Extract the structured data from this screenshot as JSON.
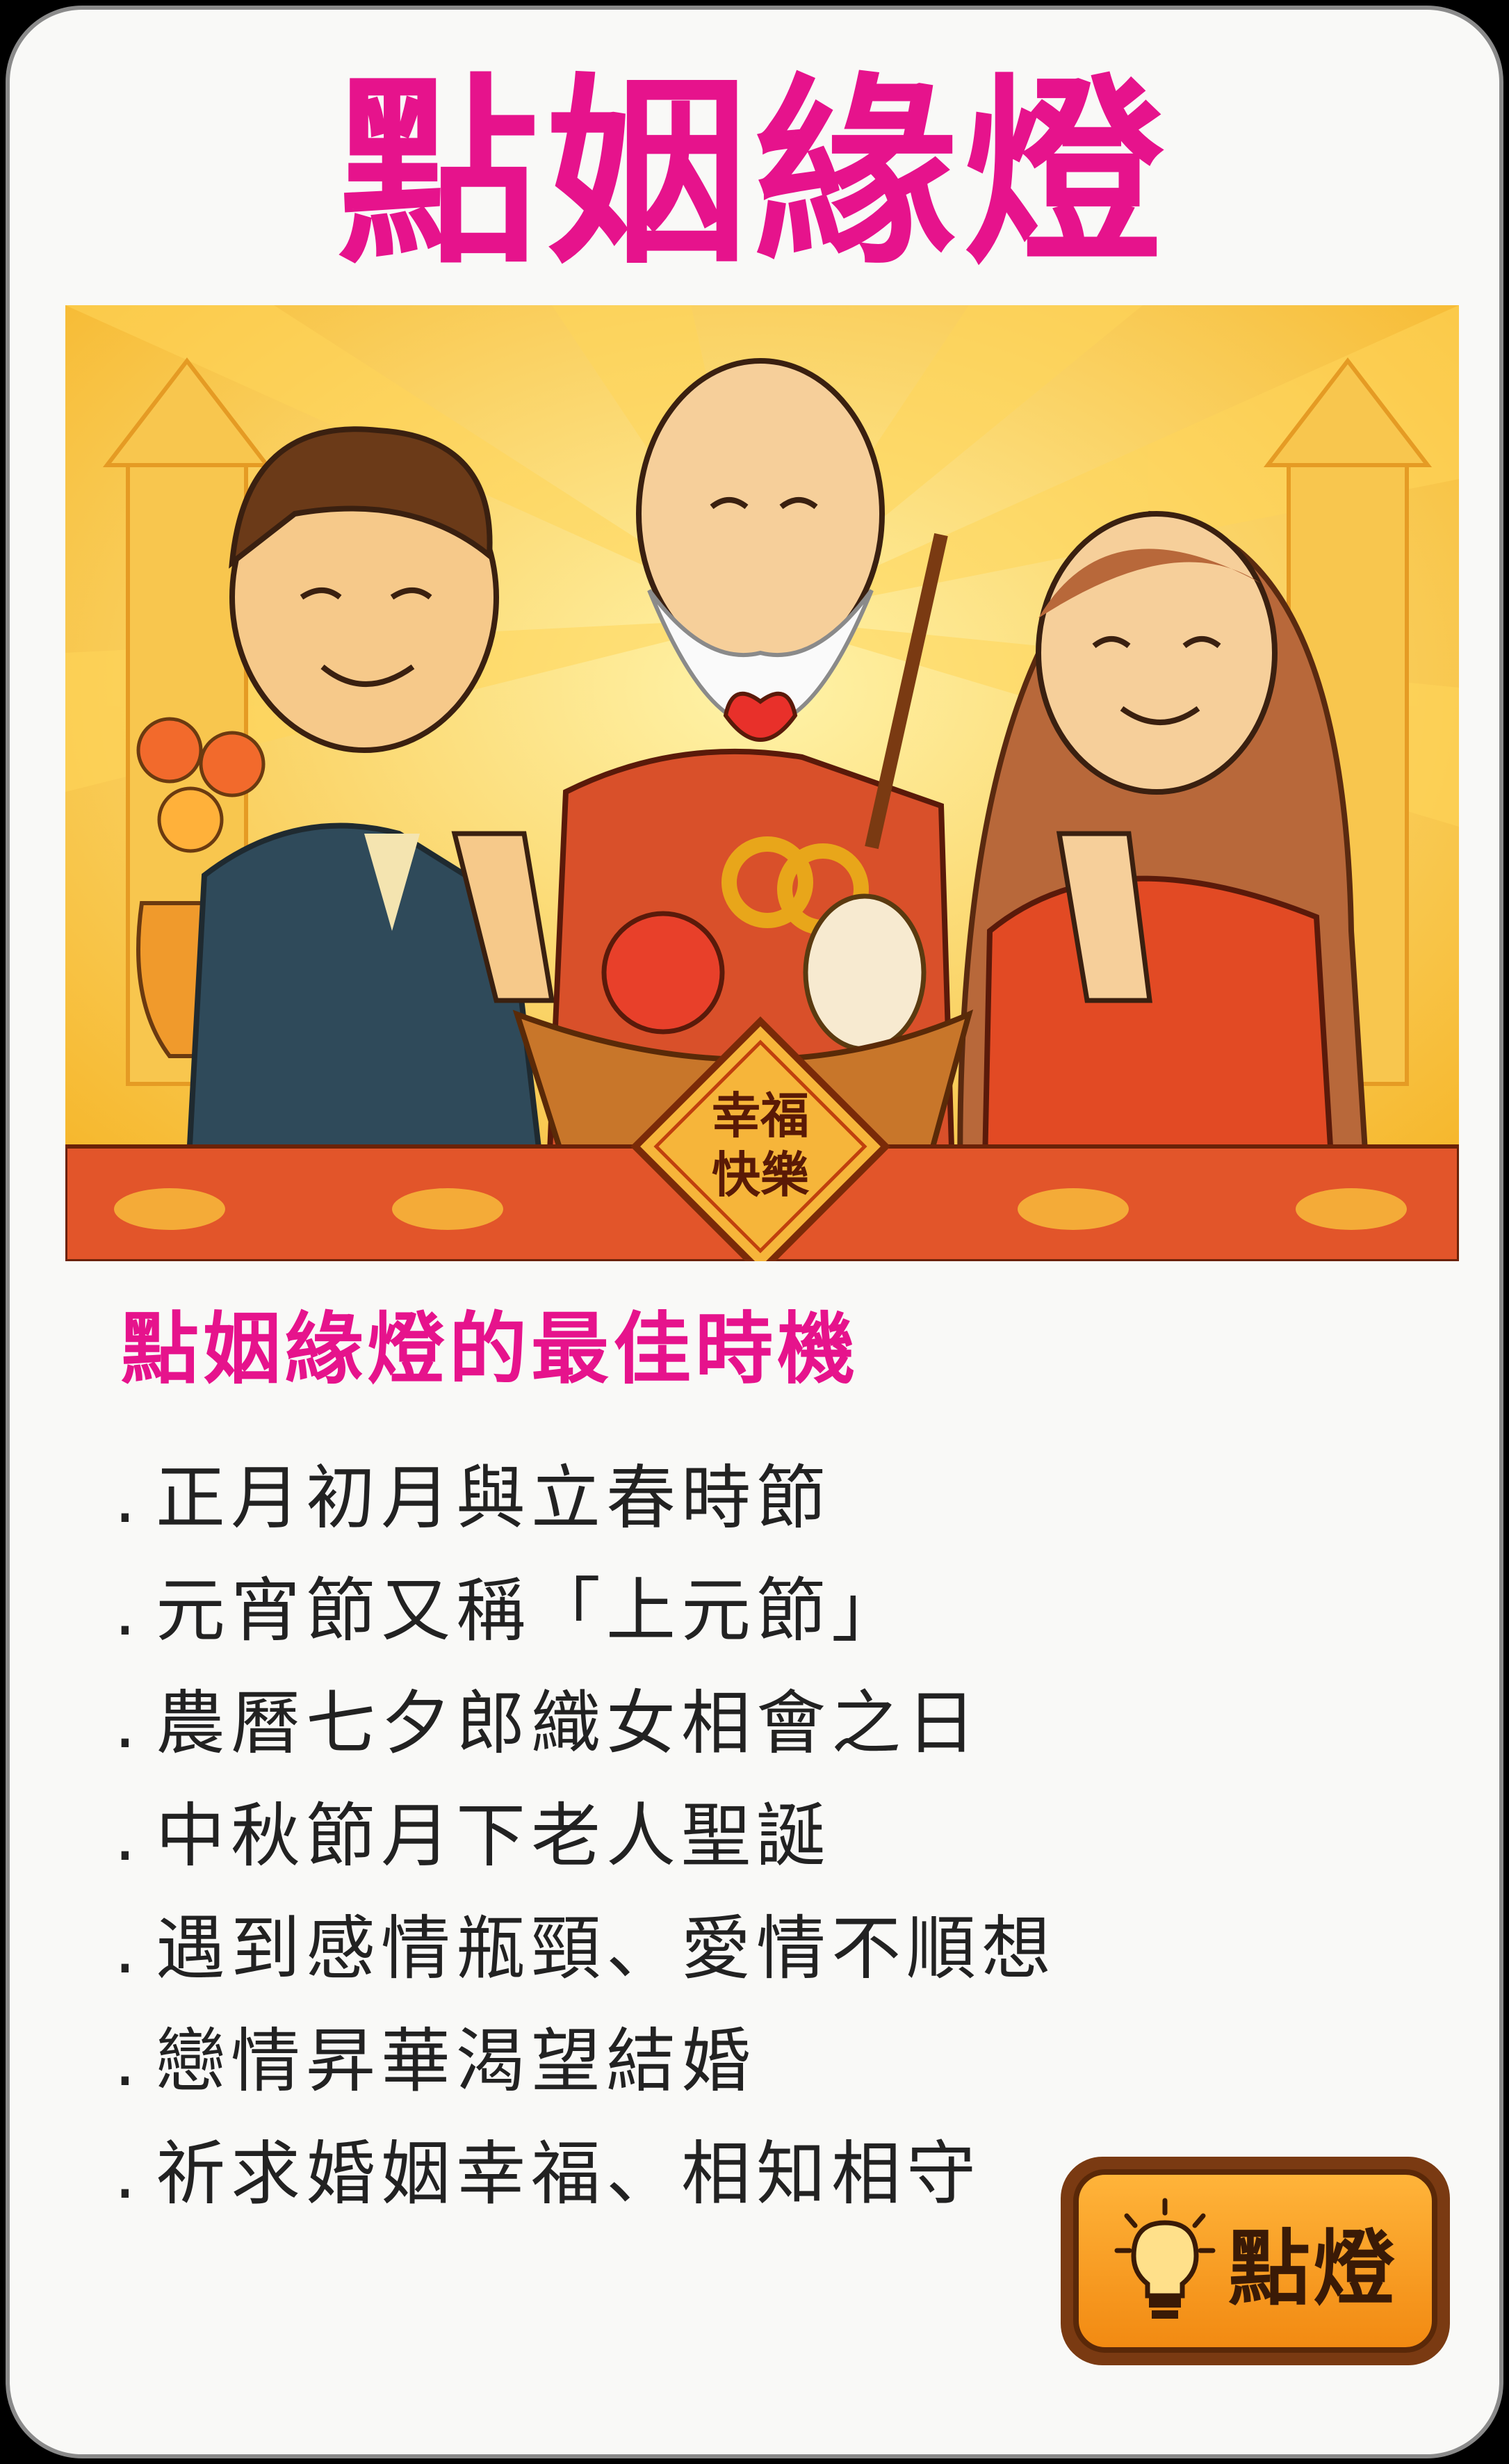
{
  "title": "點姻緣燈",
  "illustration": {
    "plaque_line1": "幸福",
    "plaque_line2": "快樂"
  },
  "section": {
    "heading": "點姻緣燈的最佳時機",
    "items": [
      {
        "bullet": ".",
        "text": "正月初月與立春時節"
      },
      {
        "bullet": ".",
        "text": "元宵節又稱「上元節」"
      },
      {
        "bullet": ".",
        "text": "農曆七夕郎織女相會之日"
      },
      {
        "bullet": ".",
        "text": "中秋節月下老人聖誕"
      },
      {
        "bullet": ".",
        "text": "遇到感情瓶頸、愛情不順想"
      },
      {
        "bullet": ".",
        "text": "戀情昇華渴望結婚"
      },
      {
        "bullet": ".",
        "text": "祈求婚姻幸福、相知相守"
      }
    ]
  },
  "cta": {
    "label": "點燈",
    "icon": "light-bulb-icon"
  },
  "colors": {
    "accent": "#e6138c",
    "button": "#f5a020",
    "text": "#222222"
  }
}
